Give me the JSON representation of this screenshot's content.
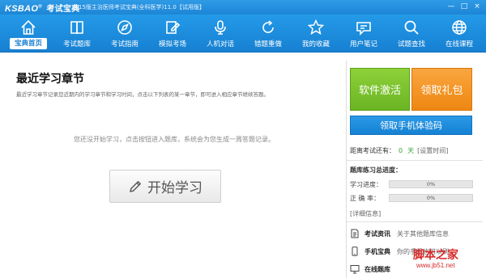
{
  "window": {
    "logo": "KSBAO",
    "logo_mark": "®",
    "logo_cn": "考试宝典",
    "title": "2015版主治医师考试宝典(全科医学)11.0【试用版】",
    "controls": [
      "—",
      "□",
      "×"
    ]
  },
  "nav": [
    {
      "label": "宝典首页",
      "icon": "home-icon",
      "active": true
    },
    {
      "label": "考试题库",
      "icon": "book-icon",
      "active": false
    },
    {
      "label": "考试指南",
      "icon": "compass-icon",
      "active": false
    },
    {
      "label": "模拟考场",
      "icon": "pencil-paper-icon",
      "active": false
    },
    {
      "label": "人机对话",
      "icon": "microphone-icon",
      "active": false
    },
    {
      "label": "错题重做",
      "icon": "redo-icon",
      "active": false
    },
    {
      "label": "我的收藏",
      "icon": "star-icon",
      "active": false
    },
    {
      "label": "用户笔记",
      "icon": "notes-icon",
      "active": false
    },
    {
      "label": "试题查找",
      "icon": "search-icon",
      "active": false
    },
    {
      "label": "在线课程",
      "icon": "globe-icon",
      "active": false
    }
  ],
  "main": {
    "title": "最近学习章节",
    "description": "最近学习章节记录您近期内的学习章节和学习时间，点击以下列表的某一章节，即可进入相应章节继续答题。",
    "empty_message": "您还没开始学习，点击按钮进入题库，系统会为您生成一周答题记录。",
    "start_button": "开始学习"
  },
  "panel": {
    "activate_button": "软件激活",
    "gift_button": "领取礼包",
    "trial_button": "领取手机体验码",
    "countdown_label": "距离考试还有：",
    "countdown_days": "0",
    "countdown_unit": "天",
    "set_time": "[设置时间]",
    "progress_title": "题库练习总进度：",
    "progress": [
      {
        "label": "学习进度：",
        "value_text": "0%",
        "value": 0
      },
      {
        "label": "正 确 率：",
        "value_text": "0%",
        "value": 0
      }
    ],
    "detail_link": "[详细信息]",
    "links": [
      {
        "icon": "document-icon",
        "title": "考试资讯",
        "desc": "关于其他题库信息"
      },
      {
        "icon": "phone-icon",
        "title": "手机宝典",
        "desc": "你的手机也可以刷"
      },
      {
        "icon": "monitor-icon",
        "title": "在线题库",
        "desc": ""
      }
    ]
  },
  "watermark": {
    "text": "脚本之家",
    "url": "www.jb51.net"
  },
  "colors": {
    "brand_blue": "#1a86d6",
    "activate_green": "#72b928",
    "gift_orange": "#f2901f",
    "countdown_green": "#31a531"
  }
}
